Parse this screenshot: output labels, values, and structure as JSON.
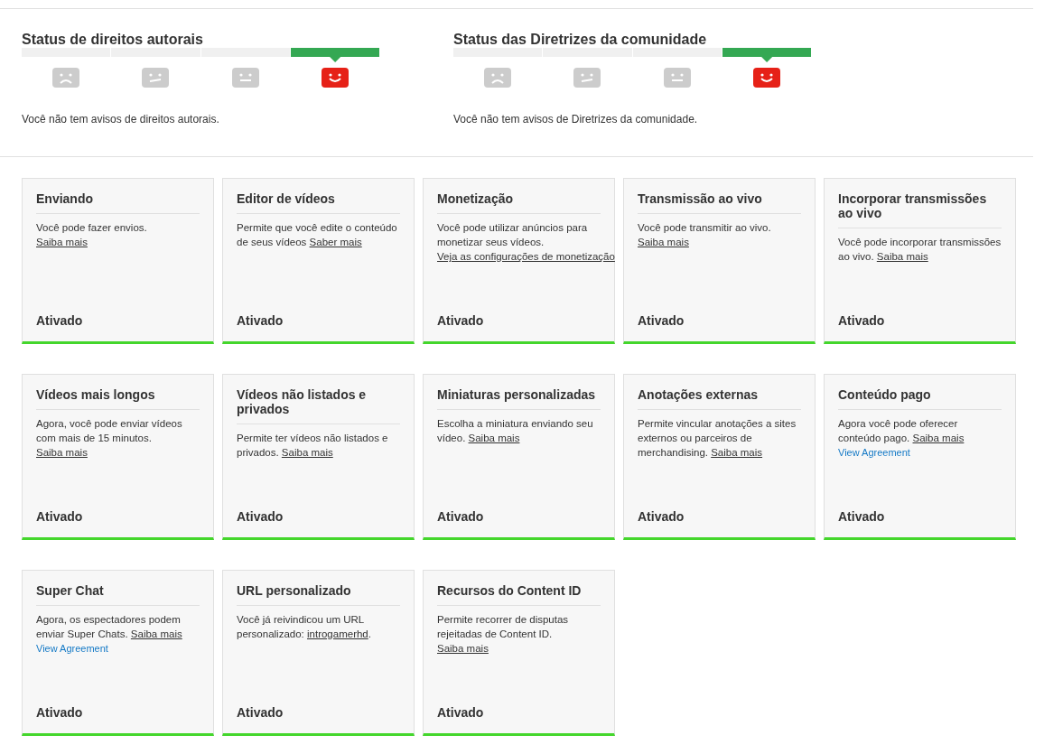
{
  "status_panels": [
    {
      "title": "Status de direitos autorais",
      "levels": [
        {
          "kind": "sad",
          "selected": false
        },
        {
          "kind": "meh",
          "selected": false
        },
        {
          "kind": "neutral",
          "selected": false
        },
        {
          "kind": "happy",
          "selected": true
        }
      ],
      "message": "Você não tem avisos de direitos autorais."
    },
    {
      "title": "Status das Diretrizes da comunidade",
      "levels": [
        {
          "kind": "sad",
          "selected": false
        },
        {
          "kind": "meh",
          "selected": false
        },
        {
          "kind": "neutral",
          "selected": false
        },
        {
          "kind": "happy",
          "selected": true
        }
      ],
      "message": "Você não tem avisos de Diretrizes da comunidade."
    }
  ],
  "features": [
    {
      "title": "Enviando",
      "text": "Você pode fazer envios. ",
      "link": "Saiba mais",
      "status": "Ativado",
      "enabled": true
    },
    {
      "title": "Editor de vídeos",
      "text": "Permite que você edite o conteúdo de seus vídeos ",
      "link": "Saber mais",
      "status": "Ativado",
      "enabled": true
    },
    {
      "title": "Monetização",
      "text": "Você pode utilizar anúncios para monetizar seus vídeos. ",
      "link": "Veja as configurações de monetização",
      "status": "Ativado",
      "enabled": true
    },
    {
      "title": "Transmissão ao vivo",
      "text": "Você pode transmitir ao vivo. ",
      "link": "Saiba mais",
      "status": "Ativado",
      "enabled": true
    },
    {
      "title": "Incorporar transmissões ao vivo",
      "text": "Você pode incorporar transmissões ao vivo. ",
      "link": "Saiba mais",
      "status": "Ativado",
      "enabled": true
    },
    {
      "title": "Vídeos mais longos",
      "text": "Agora, você pode enviar vídeos com mais de 15 minutos. ",
      "link": "Saiba mais",
      "status": "Ativado",
      "enabled": true
    },
    {
      "title": "Vídeos não listados e privados",
      "text": "Permite ter vídeos não listados e privados. ",
      "link": "Saiba mais",
      "status": "Ativado",
      "enabled": true
    },
    {
      "title": "Miniaturas personalizadas",
      "text": "Escolha a miniatura enviando seu vídeo. ",
      "link": "Saiba mais",
      "status": "Ativado",
      "enabled": true
    },
    {
      "title": "Anotações externas",
      "text": "Permite vincular anotações a sites externos ou parceiros de merchandising. ",
      "link": "Saiba mais",
      "status": "Ativado",
      "enabled": true
    },
    {
      "title": "Conteúdo pago",
      "text": "Agora você pode oferecer conteúdo pago. ",
      "link": "Saiba mais",
      "agreement": "View Agreement",
      "status": "Ativado",
      "enabled": true
    },
    {
      "title": "Super Chat",
      "text": "Agora, os espectadores podem enviar Super Chats. ",
      "link": "Saiba mais",
      "agreement": "View Agreement",
      "status": "Ativado",
      "enabled": true
    },
    {
      "title": "URL personalizado",
      "text": "Você já reivindicou um URL personalizado: ",
      "link": "introgamerhd",
      "after": ".",
      "status": "Ativado",
      "enabled": true
    },
    {
      "title": "Recursos do Content ID",
      "text": "Permite recorrer de disputas rejeitadas de Content ID. ",
      "link": "Saiba mais",
      "status": "Ativado",
      "enabled": true
    }
  ]
}
